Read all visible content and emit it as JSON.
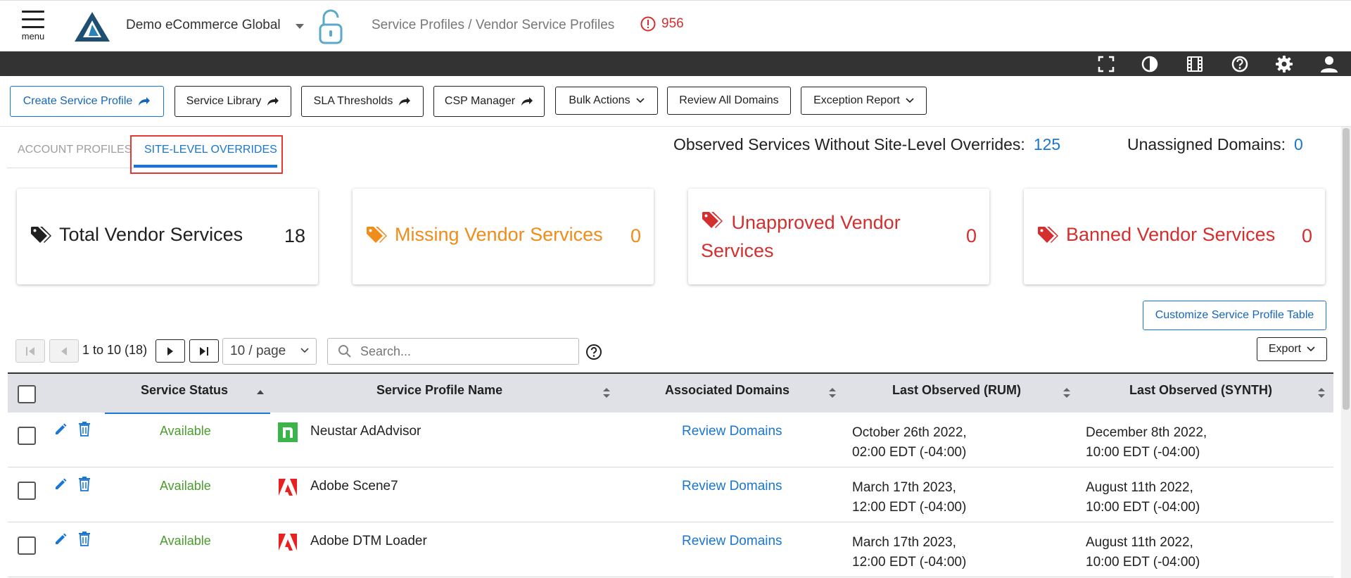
{
  "header": {
    "menu_label": "menu",
    "org_name": "Demo eCommerce Global",
    "breadcrumb": "Service Profiles / Vendor Service Profiles",
    "alert_count": "956"
  },
  "toolbar": {
    "create_service_profile": "Create Service Profile",
    "service_library": "Service Library",
    "sla_thresholds": "SLA Thresholds",
    "csp_manager": "CSP Manager",
    "bulk_actions": "Bulk Actions",
    "review_all_domains": "Review All Domains",
    "exception_report": "Exception Report"
  },
  "tabs": {
    "account_profiles": "ACCOUNT PROFILES",
    "site_level_overrides": "SITE-LEVEL OVERRIDES"
  },
  "summary": {
    "observed_label": "Observed Services Without Site-Level Overrides:",
    "observed_value": "125",
    "unassigned_label": "Unassigned Domains:",
    "unassigned_value": "0"
  },
  "cards": [
    {
      "title": "Total Vendor Services",
      "value": "18",
      "color": "#212121"
    },
    {
      "title": "Missing Vendor Services",
      "value": "0",
      "color": "#ef8c1a"
    },
    {
      "title": "Unapproved Vendor Services",
      "value": "0",
      "color": "#d32f2f"
    },
    {
      "title": "Banned Vendor Services",
      "value": "0",
      "color": "#d32f2f"
    }
  ],
  "table_controls": {
    "customize_button": "Customize Service Profile Table",
    "pagination_text": "1 to 10 (18)",
    "page_size": "10 / page",
    "search_placeholder": "Search...",
    "export_button": "Export"
  },
  "table": {
    "columns": [
      "Service Status",
      "Service Profile Name",
      "Associated Domains",
      "Last Observed (RUM)",
      "Last Observed (SYNTH)"
    ],
    "rows": [
      {
        "status": "Available",
        "name": "Neustar AdAdvisor",
        "logo": "neustar-logo",
        "domains": "Review Domains",
        "rum_date": "October 26th 2022,",
        "rum_time": "02:00 EDT (-04:00)",
        "synth_date": "December 8th 2022,",
        "synth_time": "10:00 EDT (-04:00)"
      },
      {
        "status": "Available",
        "name": "Adobe Scene7",
        "logo": "adobe-logo",
        "domains": "Review Domains",
        "rum_date": "March 17th 2023,",
        "rum_time": "12:00 EDT (-04:00)",
        "synth_date": "August 11th 2022,",
        "synth_time": "10:00 EDT (-04:00)"
      },
      {
        "status": "Available",
        "name": "Adobe DTM Loader",
        "logo": "adobe-logo",
        "domains": "Review Domains",
        "rum_date": "March 17th 2023,",
        "rum_time": "12:00 EDT (-04:00)",
        "synth_date": "August 11th 2022,",
        "synth_time": "10:00 EDT (-04:00)"
      }
    ]
  },
  "colors": {
    "accent": "#1976d2",
    "available": "#4a9d2c",
    "alert": "#d32f2f",
    "warning": "#ef8c1a",
    "darkbar": "#333333"
  }
}
